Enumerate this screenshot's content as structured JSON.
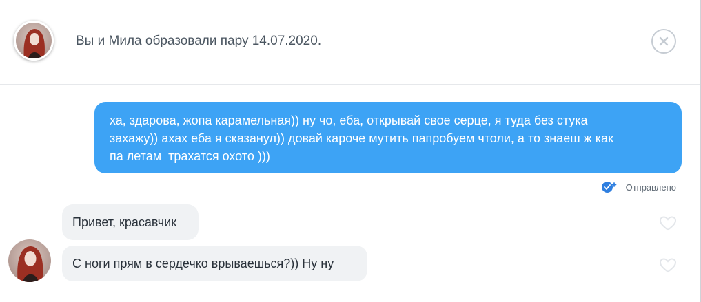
{
  "header": {
    "match_text": "Вы и Мила образовали пару 14.07.2020.",
    "avatar_icon": "user-avatar-mila",
    "close_icon": "close-circle-icon"
  },
  "messages": {
    "outgoing": {
      "lines": [
        "ха, здарова, жопа карамельная)) ну чо, еба, открывай свое серце, я туда без стука",
        "захажу)) ахах еба я сказанул)) довай кароче мутить папробуем чтоли, а то знаеш ж как",
        "па летам  трахатся охото )))"
      ],
      "status": "Отправлено",
      "status_icon": "sent-check-icon"
    },
    "incoming": [
      {
        "text": "Привет, красавчик",
        "like_icon": "heart-outline-icon"
      },
      {
        "text": "С ноги прям в сердечко врываешься?)) Ну ну",
        "like_icon": "heart-outline-icon"
      }
    ]
  },
  "colors": {
    "outgoing_bubble": "#3da3f5",
    "incoming_bubble": "#f0f2f4",
    "status_icon": "#2f7fe0",
    "divider": "#e6e8eb"
  }
}
